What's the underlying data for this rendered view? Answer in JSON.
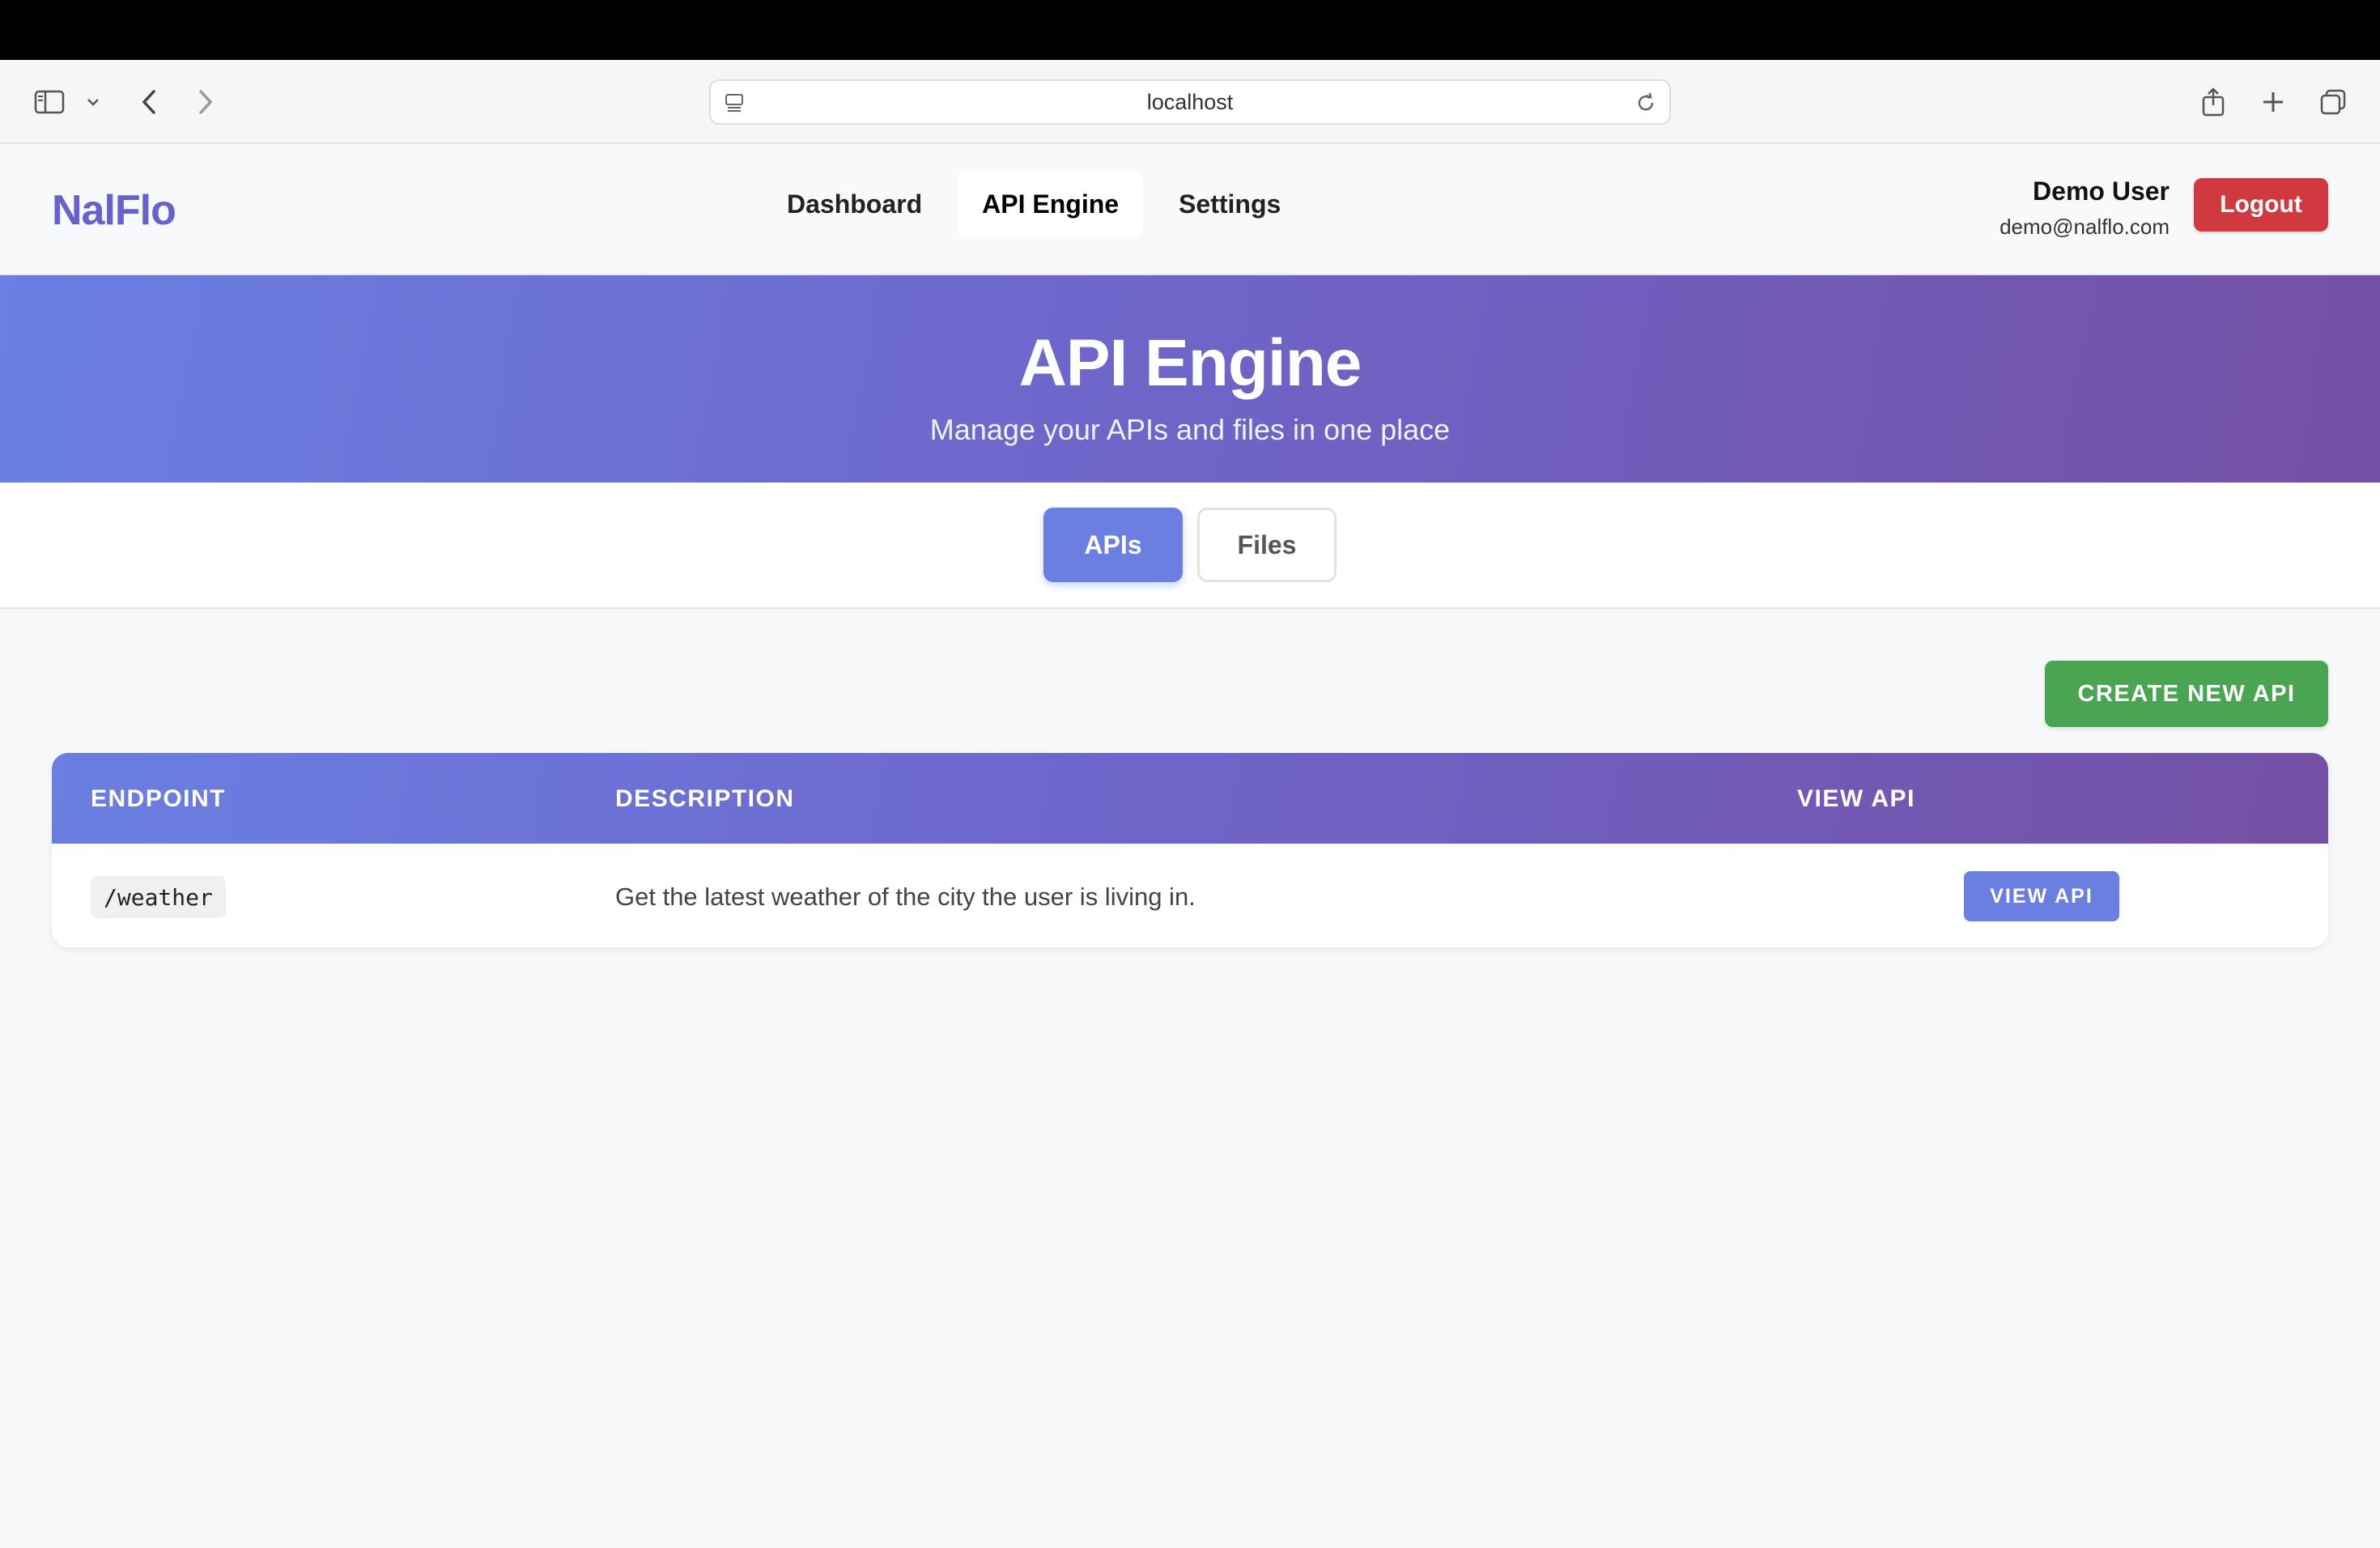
{
  "browser": {
    "url": "localhost",
    "icons": [
      "sidebar-icon",
      "chevron-down-icon",
      "back-icon",
      "forward-icon",
      "site-settings-icon",
      "reload-icon",
      "share-icon",
      "new-tab-icon",
      "tabs-overview-icon"
    ]
  },
  "header": {
    "logo": "NalFlo",
    "nav": [
      {
        "label": "Dashboard",
        "active": false
      },
      {
        "label": "API Engine",
        "active": true
      },
      {
        "label": "Settings",
        "active": false
      }
    ],
    "user": {
      "name": "Demo User",
      "email": "demo@nalflo.com"
    },
    "logout_label": "Logout"
  },
  "hero": {
    "title": "API Engine",
    "subtitle": "Manage your APIs and files in one place"
  },
  "tabs": [
    {
      "label": "APIs",
      "active": true
    },
    {
      "label": "Files",
      "active": false
    }
  ],
  "actions": {
    "create_label": "CREATE NEW API"
  },
  "table": {
    "columns": [
      "ENDPOINT",
      "DESCRIPTION",
      "VIEW API"
    ],
    "rows": [
      {
        "endpoint": "/weather",
        "description": "Get the latest weather of the city the user is living in.",
        "action_label": "VIEW API"
      }
    ]
  },
  "colors": {
    "brand": "#6a5fcf",
    "gradient_start": "#6a7fe2",
    "gradient_end": "#7450a5",
    "primary_button": "#6b7fe3",
    "success_button": "#4aa552",
    "danger_button": "#d0393f"
  }
}
